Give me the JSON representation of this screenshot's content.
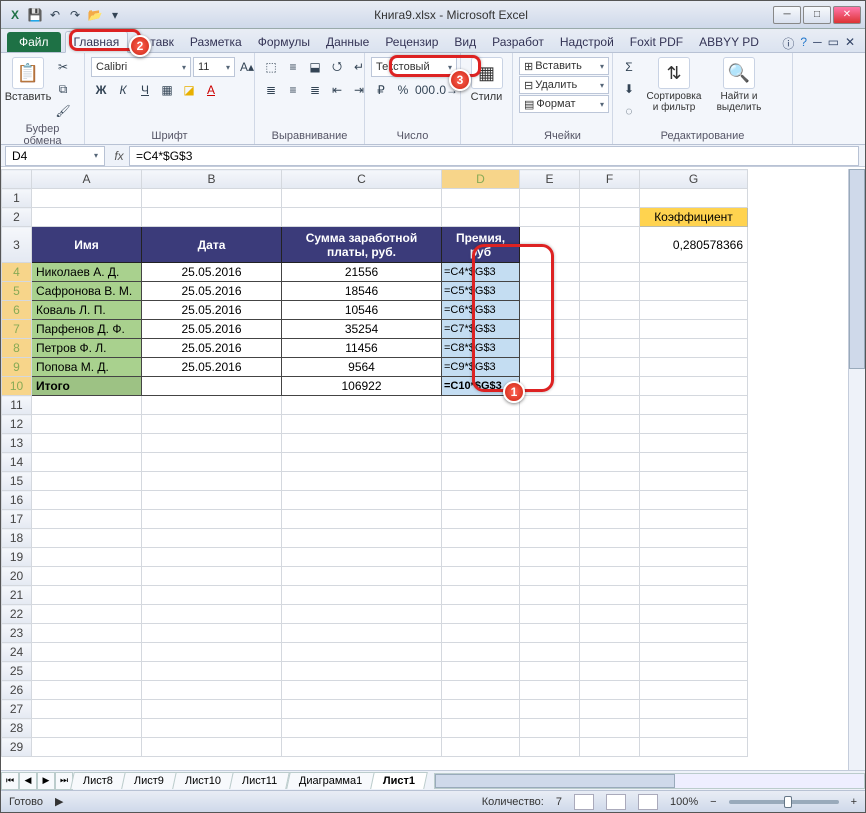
{
  "window": {
    "title": "Книга9.xlsx - Microsoft Excel"
  },
  "qat": {
    "save": "💾",
    "undo": "↶",
    "redo": "↷",
    "open": "📂"
  },
  "tabs": {
    "file": "Файл",
    "items": [
      "Главная",
      "Вставк",
      "Разметка",
      "Формулы",
      "Данные",
      "Рецензир",
      "Вид",
      "Разработ",
      "Надстрой",
      "Foxit PDF",
      "ABBYY PD"
    ],
    "active_index": 0
  },
  "ribbon": {
    "clipboard": {
      "paste": "Вставить",
      "caption": "Буфер обмена"
    },
    "font": {
      "name": "Calibri",
      "size": "11",
      "caption": "Шрифт"
    },
    "align": {
      "caption": "Выравнивание"
    },
    "number": {
      "format": "Текстовый",
      "caption": "Число"
    },
    "styles": {
      "caption": "Стили"
    },
    "cells": {
      "insert": "Вставить",
      "delete": "Удалить",
      "format": "Формат",
      "caption": "Ячейки"
    },
    "editing": {
      "sort": "Сортировка и фильтр",
      "find": "Найти и выделить",
      "caption": "Редактирование"
    }
  },
  "fbar": {
    "name": "D4",
    "formula": "=C4*$G$3"
  },
  "columns": [
    "A",
    "B",
    "C",
    "D",
    "E",
    "F",
    "G"
  ],
  "headers": {
    "name": "Имя",
    "date": "Дата",
    "sum": "Сумма заработной платы, руб.",
    "bonus": "Премия, руб",
    "coeff": "Коэффициент"
  },
  "coeff": "0,280578366",
  "rows": [
    {
      "n": "Николаев А. Д.",
      "d": "25.05.2016",
      "s": "21556",
      "f": "=C4*$G$3"
    },
    {
      "n": "Сафронова В. М.",
      "d": "25.05.2016",
      "s": "18546",
      "f": "=C5*$G$3"
    },
    {
      "n": "Коваль Л. П.",
      "d": "25.05.2016",
      "s": "10546",
      "f": "=C6*$G$3"
    },
    {
      "n": "Парфенов Д. Ф.",
      "d": "25.05.2016",
      "s": "35254",
      "f": "=C7*$G$3"
    },
    {
      "n": "Петров Ф. Л.",
      "d": "25.05.2016",
      "s": "11456",
      "f": "=C8*$G$3"
    },
    {
      "n": "Попова М. Д.",
      "d": "25.05.2016",
      "s": "9564",
      "f": "=C9*$G$3"
    }
  ],
  "total": {
    "label": "Итого",
    "sum": "106922",
    "f": "=C10*$G$3"
  },
  "sheets": {
    "items": [
      "Лист8",
      "Лист9",
      "Лист10",
      "Лист11",
      "Диаграмма1",
      "Лист1"
    ],
    "active_index": 5
  },
  "status": {
    "ready": "Готово",
    "count_label": "Количество:",
    "count": "7",
    "zoom": "100%"
  },
  "callouts": {
    "1": "1",
    "2": "2",
    "3": "3"
  }
}
